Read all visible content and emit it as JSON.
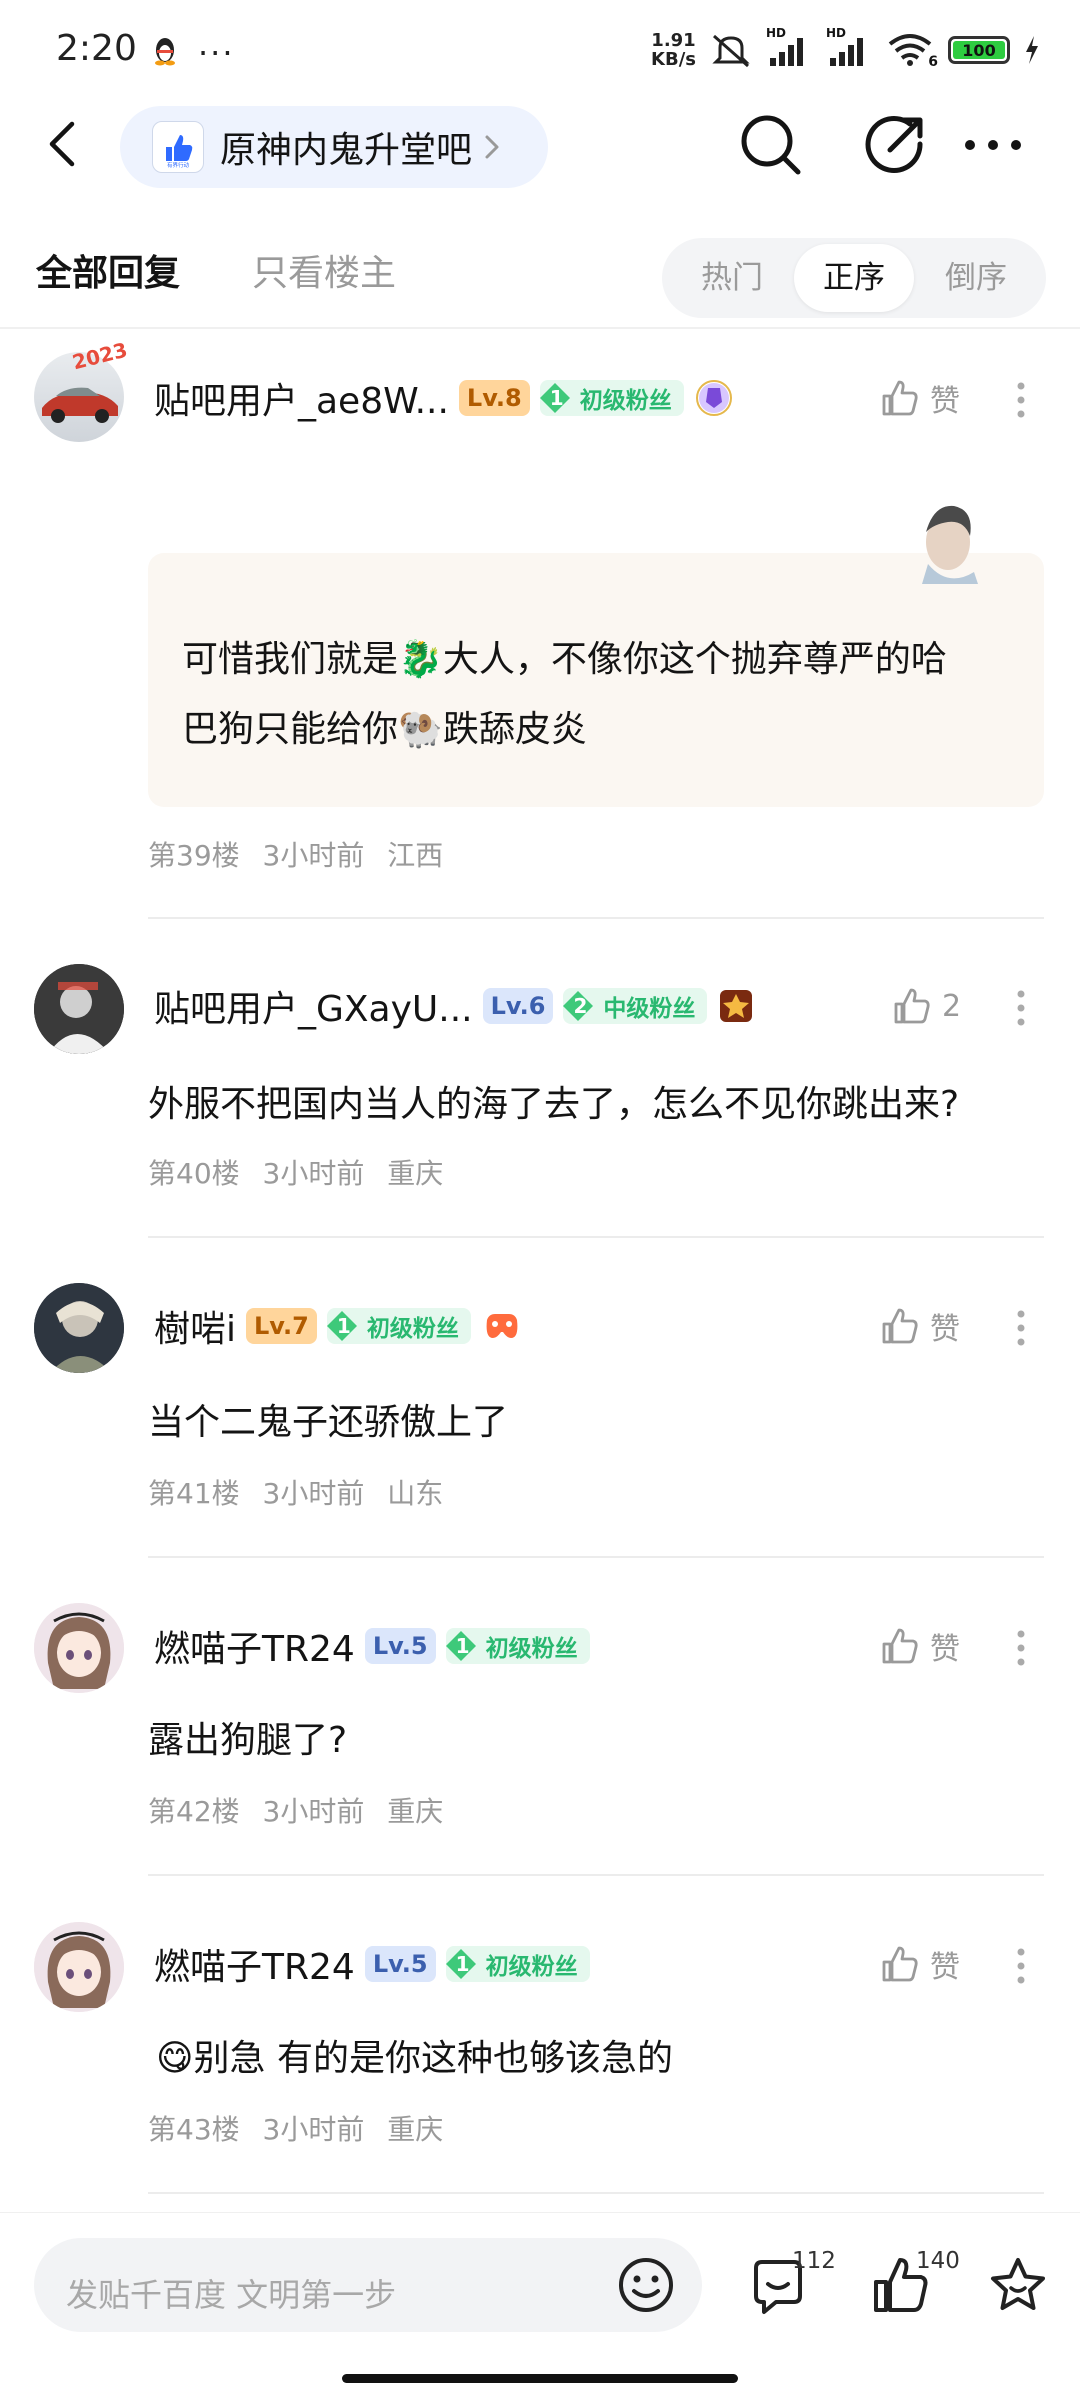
{
  "status_bar": {
    "time": "2:20",
    "dots": "···",
    "net_speed_value": "1.91",
    "net_speed_unit": "KB/s",
    "hd_label": "HD",
    "wifi_badge": "6",
    "battery": "100"
  },
  "nav": {
    "forum_name": "原神内鬼升堂吧",
    "forum_logo_text": "有界行动"
  },
  "tabs": {
    "all_replies": "全部回复",
    "op_only": "只看楼主"
  },
  "sort": {
    "hot": "热门",
    "asc": "正序",
    "desc": "倒序",
    "selected": "正序"
  },
  "posts": [
    {
      "username": "贴吧用户_ae8W...",
      "level": "Lv.8",
      "fan_number": "1",
      "fan_label": "初级粉丝",
      "avatar_badge": "2023",
      "likes": "赞",
      "content_line1": "可惜我们就是🐉大人，不像你这个抛弃尊严的哈",
      "content_line2": "巴狗只能给你🐏跌舔皮炎",
      "meta": "第39楼  3小时前  江西"
    },
    {
      "username": "贴吧用户_GXayU...",
      "level": "Lv.6",
      "fan_number": "2",
      "fan_label": "中级粉丝",
      "likes": "2",
      "content": "外服不把国内当人的海了去了，怎么不见你跳出来?",
      "meta": "第40楼  3小时前  重庆"
    },
    {
      "username": "樹啱i",
      "level": "Lv.7",
      "fan_number": "1",
      "fan_label": "初级粉丝",
      "likes": "赞",
      "content": "当个二鬼子还骄傲上了",
      "meta": "第41楼  3小时前  山东"
    },
    {
      "username": "燃喵子TR24",
      "level": "Lv.5",
      "fan_number": "1",
      "fan_label": "初级粉丝",
      "likes": "赞",
      "content": "露出狗腿了?",
      "meta": "第42楼  3小时前  重庆"
    },
    {
      "username": "燃喵子TR24",
      "level": "Lv.5",
      "fan_number": "1",
      "fan_label": "初级粉丝",
      "likes": "赞",
      "content": "😋别急 有的是你这种也够该急的",
      "meta": "第43楼  3小时前  重庆"
    }
  ],
  "bottom_bar": {
    "input_placeholder": "发贴千百度 文明第一步",
    "comment_count": "112",
    "like_count": "140"
  },
  "colors": {
    "fan_green": "#29b870",
    "level_orange_bg": "#ffd59b",
    "level_blue_bg": "#dbe6fb",
    "pill_bg": "#eef3fe",
    "bubble_bg": "#fbf7f2"
  }
}
